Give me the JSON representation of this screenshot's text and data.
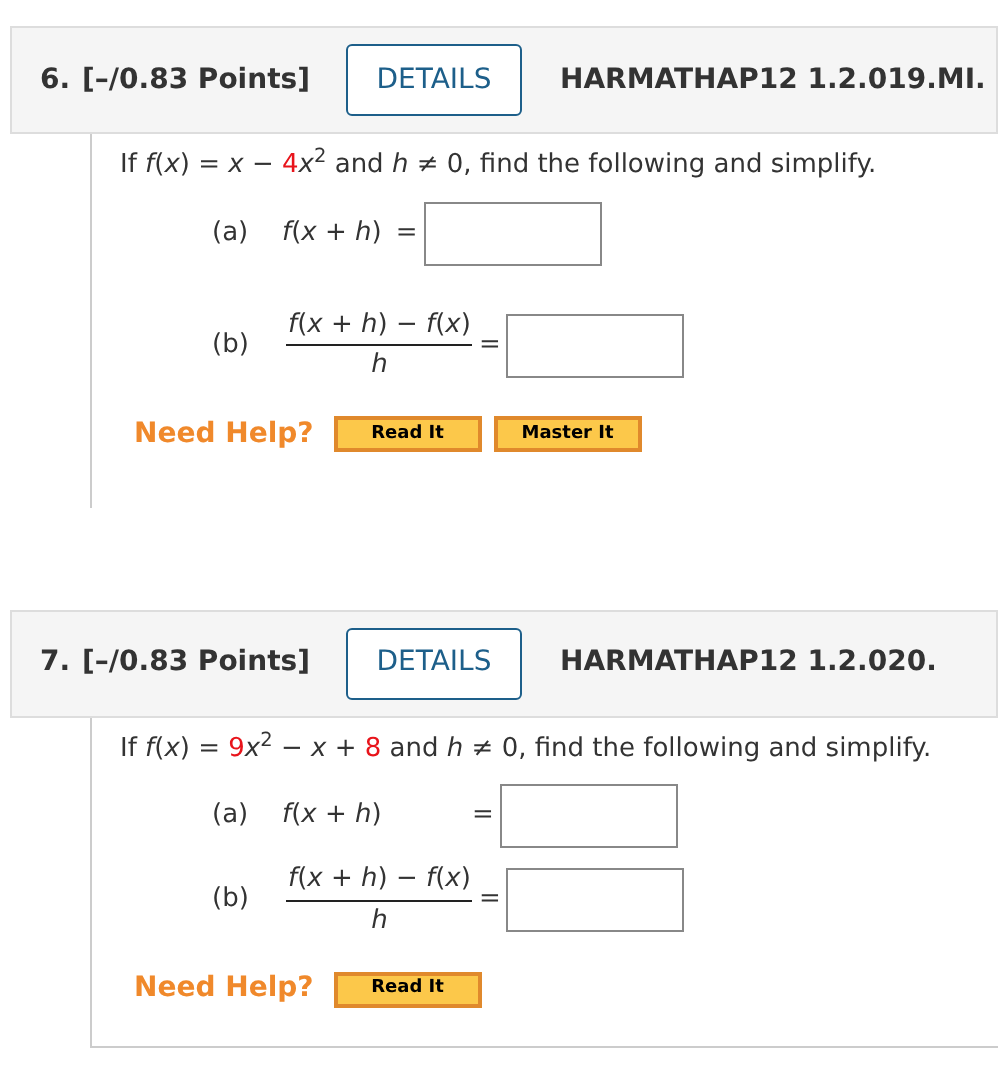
{
  "questions": [
    {
      "number": "6.",
      "points": "[–/0.83 Points]",
      "details_button": "DETAILS",
      "code": "HARMATHAP12 1.2.019.MI.",
      "prompt": [
        {
          "kind": "plain",
          "text": "If *f*(*x*) = *x* − "
        },
        {
          "kind": "param",
          "text": "4"
        },
        {
          "kind": "plain",
          "text": "*x*$^{2}$ and *h* ≠ 0, find the following and simplify."
        }
      ],
      "parts": [
        {
          "kind": "inline",
          "label": "(a)",
          "expression": "*f*(*x* + *h*)",
          "equals": "="
        },
        {
          "kind": "fraction",
          "label": "(b)",
          "numerator": "*f*(*x* + *h*) − *f*(*x*)",
          "denominator": "*h*",
          "equals": "="
        }
      ],
      "help_label": "Need Help?",
      "help_buttons": [
        "Read It",
        "Master It"
      ]
    },
    {
      "number": "7.",
      "points": "[–/0.83 Points]",
      "details_button": "DETAILS",
      "code": "HARMATHAP12 1.2.020.",
      "prompt": [
        {
          "kind": "plain",
          "text": "If *f*(*x*) = "
        },
        {
          "kind": "param",
          "text": "9"
        },
        {
          "kind": "plain",
          "text": "*x*$^{2}$ − *x* + "
        },
        {
          "kind": "param",
          "text": "8"
        },
        {
          "kind": "plain",
          "text": " and *h* ≠ 0, find the following and simplify."
        }
      ],
      "parts": [
        {
          "kind": "inline_wide",
          "label": "(a)",
          "expression": "*f*(*x* + *h*)",
          "equals": "="
        },
        {
          "kind": "fraction",
          "label": "(b)",
          "numerator": "*f*(*x* + *h*) − *f*(*x*)",
          "denominator": "*h*",
          "equals": "="
        }
      ],
      "help_label": "Need Help?",
      "help_buttons": [
        "Read It"
      ]
    }
  ]
}
